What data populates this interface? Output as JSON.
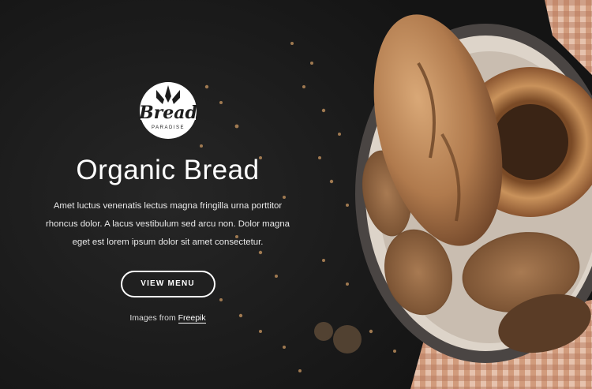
{
  "brand": {
    "logo_word": "Bread",
    "logo_sub": "PARADISE"
  },
  "hero": {
    "title": "Organic Bread",
    "description": "Amet luctus venenatis lectus magna fringilla urna porttitor rhoncus dolor. A lacus vestibulum sed arcu non. Dolor magna eget est lorem ipsum dolor sit amet consectetur.",
    "button_label": "VIEW MENU",
    "credit_prefix": "Images from ",
    "credit_link": "Freepik"
  },
  "colors": {
    "background": "#1c1c1c",
    "text": "#ffffff",
    "accent_button_border": "#ffffff",
    "tablecloth": "#c98d6c"
  }
}
